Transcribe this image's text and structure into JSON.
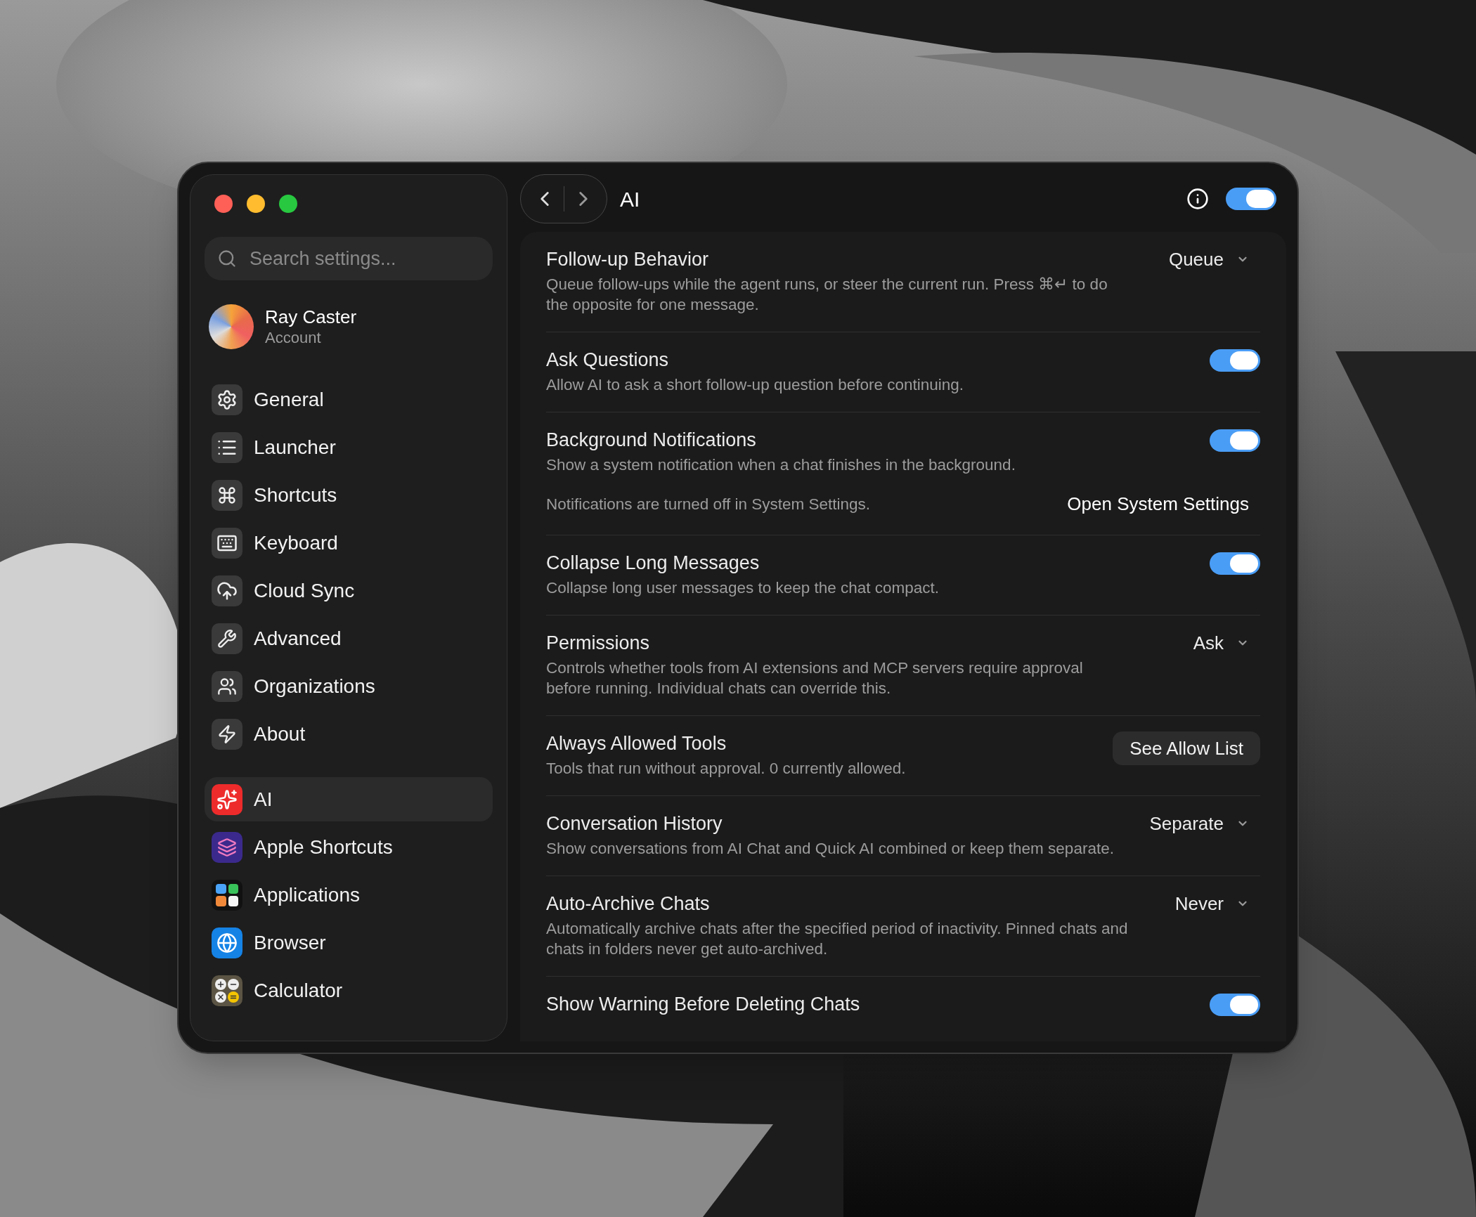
{
  "sidebar": {
    "search": {
      "placeholder": "Search settings..."
    },
    "account": {
      "name": "Ray Caster",
      "subtitle": "Account"
    },
    "groups": [
      {
        "items": [
          {
            "label": "General",
            "selected": false
          },
          {
            "label": "Launcher",
            "selected": false
          },
          {
            "label": "Shortcuts",
            "selected": false
          },
          {
            "label": "Keyboard",
            "selected": false
          },
          {
            "label": "Cloud Sync",
            "selected": false
          },
          {
            "label": "Advanced",
            "selected": false
          },
          {
            "label": "Organizations",
            "selected": false
          },
          {
            "label": "About",
            "selected": false
          }
        ]
      },
      {
        "items": [
          {
            "label": "AI",
            "selected": true
          },
          {
            "label": "Apple Shortcuts",
            "selected": false
          },
          {
            "label": "Applications",
            "selected": false
          },
          {
            "label": "Browser",
            "selected": false
          },
          {
            "label": "Calculator",
            "selected": false
          }
        ]
      }
    ]
  },
  "header": {
    "title": "AI",
    "enabled": true
  },
  "settings": [
    {
      "kind": "dropdown",
      "title": "Follow-up Behavior",
      "description": "Queue follow-ups while the agent runs, or steer the current run. Press ⌘↵ to do the opposite for one message.",
      "value": "Queue"
    },
    {
      "kind": "toggle",
      "title": "Ask Questions",
      "description": "Allow AI to ask a short follow-up question before continuing.",
      "on": true
    },
    {
      "kind": "toggle",
      "title": "Background Notifications",
      "description": "Show a system notification when a chat finishes in the background.",
      "on": true,
      "note": "Notifications are turned off in System Settings.",
      "note_link": "Open System Settings"
    },
    {
      "kind": "toggle",
      "title": "Collapse Long Messages",
      "description": "Collapse long user messages to keep the chat compact.",
      "on": true
    },
    {
      "kind": "dropdown",
      "title": "Permissions",
      "description": "Controls whether tools from AI extensions and MCP servers require approval before running. Individual chats can override this.",
      "value": "Ask"
    },
    {
      "kind": "button",
      "title": "Always Allowed Tools",
      "description": "Tools that run without approval. 0 currently allowed.",
      "button": "See Allow List"
    },
    {
      "kind": "dropdown",
      "title": "Conversation History",
      "description": "Show conversations from AI Chat and Quick AI combined or keep them separate.",
      "value": "Separate"
    },
    {
      "kind": "dropdown",
      "title": "Auto-Archive Chats",
      "description": "Automatically archive chats after the specified period of inactivity. Pinned chats and chats in folders never get auto-archived.",
      "value": "Never"
    },
    {
      "kind": "toggle",
      "title": "Show Warning Before Deleting Chats",
      "on": true
    }
  ]
}
